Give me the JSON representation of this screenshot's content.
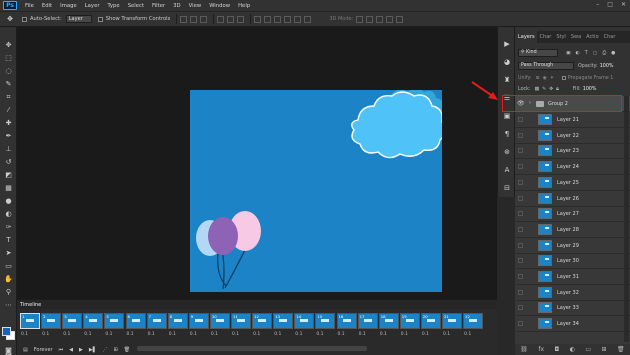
{
  "menu": {
    "logo": "Ps",
    "items": [
      "File",
      "Edit",
      "Image",
      "Layer",
      "Type",
      "Select",
      "Filter",
      "3D",
      "View",
      "Window",
      "Help"
    ]
  },
  "options": {
    "auto_select_label": "Auto-Select:",
    "auto_select_value": "Layer",
    "transform_label": "Show Transform Controls",
    "mode_3d": "3D Mode:"
  },
  "panel": {
    "tabs": [
      "Layers",
      "Char",
      "Styl",
      "Swa",
      "Actio",
      "Char"
    ],
    "kind_label": "Kind",
    "blend_mode": "Pass Through",
    "opacity_label": "Opacity:",
    "opacity_value": "100%",
    "unify_label": "Unify:",
    "propagate_label": "Propagate Frame 1",
    "lock_label": "Lock:",
    "fill_label": "Fill:",
    "fill_value": "100%",
    "group_name": "Group 2",
    "layers": [
      "Layer 21",
      "Layer 22",
      "Layer 23",
      "Layer 24",
      "Layer 25",
      "Layer 26",
      "Layer 27",
      "Layer 28",
      "Layer 29",
      "Layer 30",
      "Layer 31",
      "Layer 32",
      "Layer 33",
      "Layer 34"
    ]
  },
  "timeline": {
    "title": "Timeline",
    "loop": "Forever",
    "frames": [
      {
        "n": "1",
        "d": "0.1"
      },
      {
        "n": "2",
        "d": "0.1"
      },
      {
        "n": "3",
        "d": "0.1"
      },
      {
        "n": "4",
        "d": "0.1"
      },
      {
        "n": "5",
        "d": "0.1"
      },
      {
        "n": "6",
        "d": "0.1"
      },
      {
        "n": "7",
        "d": "0.1"
      },
      {
        "n": "8",
        "d": "0.1"
      },
      {
        "n": "9",
        "d": "0.1"
      },
      {
        "n": "10",
        "d": "0.1"
      },
      {
        "n": "11",
        "d": "0.1"
      },
      {
        "n": "12",
        "d": "0.1"
      },
      {
        "n": "13",
        "d": "0.1"
      },
      {
        "n": "14",
        "d": "0.1"
      },
      {
        "n": "15",
        "d": "0.1"
      },
      {
        "n": "16",
        "d": "0.1"
      },
      {
        "n": "17",
        "d": "0.1"
      },
      {
        "n": "18",
        "d": "0.1"
      },
      {
        "n": "19",
        "d": "0.1"
      },
      {
        "n": "20",
        "d": "0.1"
      },
      {
        "n": "21",
        "d": "0.1"
      },
      {
        "n": "22",
        "d": "0.1"
      }
    ]
  },
  "colors": {
    "canvas_bg": "#1b83c6",
    "cloud": "#4fc3f7",
    "balloon_pink": "#f8c9e4",
    "balloon_purple": "#8e63b5",
    "balloon_light": "#b3d8f5",
    "highlight": "#e21b1b"
  }
}
